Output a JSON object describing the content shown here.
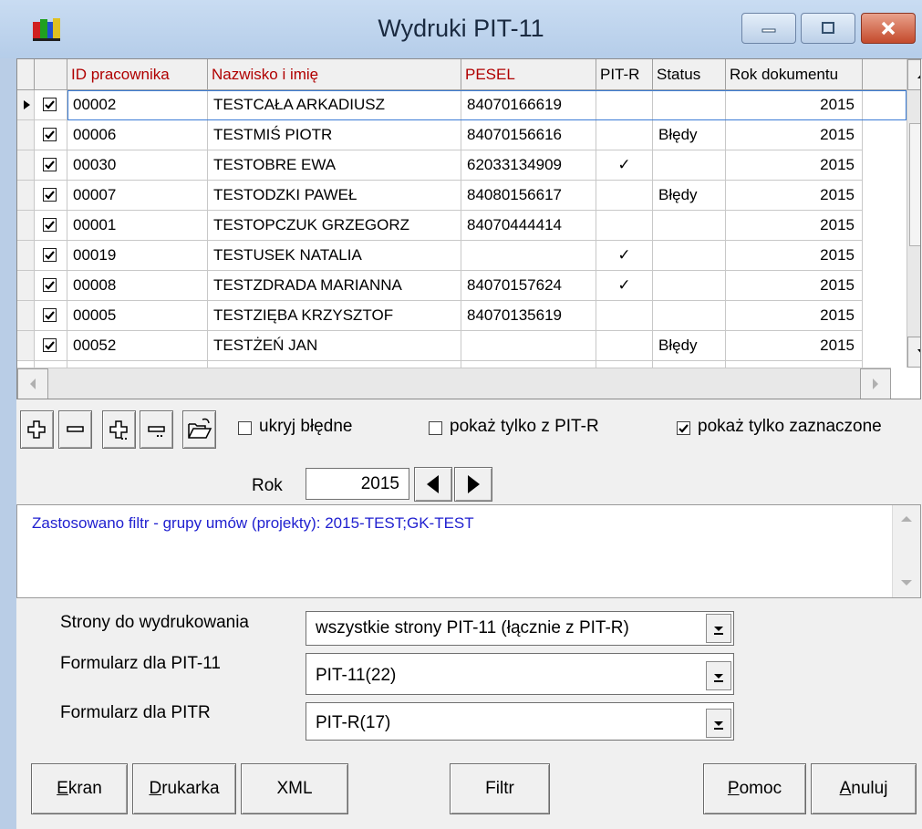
{
  "window": {
    "title": "Wydruki PIT-11"
  },
  "grid": {
    "columns": [
      "ID pracownika",
      "Nazwisko i imię",
      "PESEL",
      "PIT-R",
      "Status",
      "Rok dokumentu"
    ],
    "rows": [
      {
        "checked": true,
        "id": "00002",
        "name": "TESTCAŁA ARKADIUSZ",
        "pesel": "84070166619",
        "pitr": "",
        "status": "",
        "year": "2015"
      },
      {
        "checked": true,
        "id": "00006",
        "name": "TESTMIŚ PIOTR",
        "pesel": "84070156616",
        "pitr": "",
        "status": "Błędy",
        "year": "2015"
      },
      {
        "checked": true,
        "id": "00030",
        "name": "TESTOBRE EWA",
        "pesel": "62033134909",
        "pitr": "✓",
        "status": "",
        "year": "2015"
      },
      {
        "checked": true,
        "id": "00007",
        "name": "TESTODZKI PAWEŁ",
        "pesel": "84080156617",
        "pitr": "",
        "status": "Błędy",
        "year": "2015"
      },
      {
        "checked": true,
        "id": "00001",
        "name": "TESTOPCZUK GRZEGORZ",
        "pesel": "84070444414",
        "pitr": "",
        "status": "",
        "year": "2015"
      },
      {
        "checked": true,
        "id": "00019",
        "name": "TESTUSEK NATALIA",
        "pesel": "",
        "pitr": "✓",
        "status": "",
        "year": "2015"
      },
      {
        "checked": true,
        "id": "00008",
        "name": "TESTZDRADA MARIANNA",
        "pesel": "84070157624",
        "pitr": "✓",
        "status": "",
        "year": "2015"
      },
      {
        "checked": true,
        "id": "00005",
        "name": "TESTZIĘBA KRZYSZTOF",
        "pesel": "84070135619",
        "pitr": "",
        "status": "",
        "year": "2015"
      },
      {
        "checked": true,
        "id": "00052",
        "name": "TESTŻEŃ JAN",
        "pesel": "",
        "pitr": "",
        "status": "Błędy",
        "year": "2015"
      }
    ]
  },
  "filters": {
    "hide_errors": {
      "label": "ukryj błędne",
      "checked": false
    },
    "only_pitr": {
      "label": "pokaż tylko z PIT-R",
      "checked": false
    },
    "only_selected": {
      "label": "pokaż tylko zaznaczone",
      "checked": true
    }
  },
  "year": {
    "label": "Rok",
    "value": "2015"
  },
  "info": {
    "text": "Zastosowano filtr - grupy umów (projekty): 2015-TEST;GK-TEST"
  },
  "form": {
    "pages": {
      "label": "Strony do wydrukowania",
      "value": "wszystkie strony PIT-11 (łącznie z PIT-R)"
    },
    "pit11_form": {
      "label": "Formularz dla PIT-11",
      "value": "PIT-11(22)"
    },
    "pitr_form": {
      "label": "Formularz dla PITR",
      "value": "PIT-R(17)"
    }
  },
  "buttons": {
    "screen": {
      "mnemonic": "E",
      "rest": "kran"
    },
    "printer": {
      "mnemonic": "D",
      "rest": "rukarka"
    },
    "xml": "XML",
    "filter": "Filtr",
    "help": {
      "mnemonic": "P",
      "rest": "omoc"
    },
    "cancel": {
      "mnemonic": "A",
      "rest": "nuluj"
    }
  },
  "colors": {
    "header_text": "#b00000",
    "info_text": "#2020d0",
    "title_bar": "#c9dcf2"
  }
}
